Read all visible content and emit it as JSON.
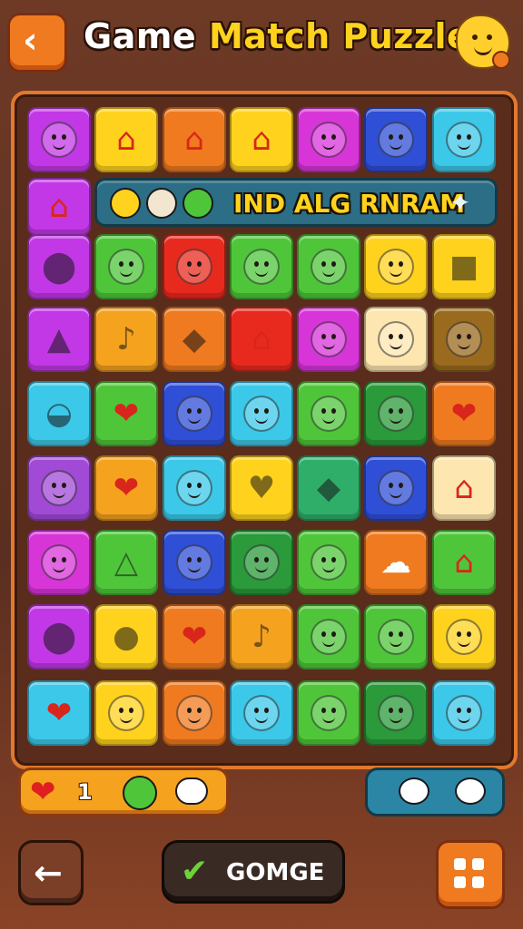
{
  "header": {
    "title_word1": "Game",
    "title_word2": "Match",
    "title_word3": "Puzzle",
    "back_icon": "chevron-left-icon",
    "profile_icon": "cookie-face-icon"
  },
  "banner": {
    "text": "IND ALG RNRAM",
    "icons": [
      "bell-icon",
      "owl-icon",
      "green-face-icon"
    ],
    "pin_icon": "pin-icon"
  },
  "board": {
    "rows": [
      [
        {
          "c": "#c238e6",
          "i": "face"
        },
        {
          "c": "#ffd21e",
          "i": "cupcake"
        },
        {
          "c": "#f07a1f",
          "i": "cupcake"
        },
        {
          "c": "#ffd21e",
          "i": "cupcake"
        },
        {
          "c": "#d835d8",
          "i": "face"
        },
        {
          "c": "#2f4fd6",
          "i": "face"
        },
        {
          "c": "#3cc8e8",
          "i": "face"
        }
      ],
      [
        {
          "c": "#c238e6",
          "i": "cupcake"
        }
      ],
      [
        {
          "c": "#c238e6",
          "i": "beetle"
        },
        {
          "c": "#4fc63a",
          "i": "face"
        },
        {
          "c": "#e82a1e",
          "i": "face"
        },
        {
          "c": "#4fc63a",
          "i": "face"
        },
        {
          "c": "#4fc63a",
          "i": "face"
        },
        {
          "c": "#ffd21e",
          "i": "face"
        },
        {
          "c": "#ffd21e",
          "i": "card"
        }
      ],
      [
        {
          "c": "#c238e6",
          "i": "boat"
        },
        {
          "c": "#f5a21f",
          "i": "bell"
        },
        {
          "c": "#f07a1f",
          "i": "diamond"
        },
        {
          "c": "#e82a1e",
          "i": "cupcake"
        },
        {
          "c": "#d835d8",
          "i": "face"
        },
        {
          "c": "#fde6b0",
          "i": "face"
        },
        {
          "c": "#9a6a1e",
          "i": "face"
        }
      ],
      [
        {
          "c": "#3cc8e8",
          "i": "shell"
        },
        {
          "c": "#4fc63a",
          "i": "heart"
        },
        {
          "c": "#2f4fd6",
          "i": "face"
        },
        {
          "c": "#3cc8e8",
          "i": "face"
        },
        {
          "c": "#4fc63a",
          "i": "face"
        },
        {
          "c": "#2a9a3a",
          "i": "face"
        },
        {
          "c": "#f07a1f",
          "i": "heart"
        }
      ],
      [
        {
          "c": "#a04ad6",
          "i": "face"
        },
        {
          "c": "#f5a21f",
          "i": "heart"
        },
        {
          "c": "#3cc8e8",
          "i": "face"
        },
        {
          "c": "#ffd21e",
          "i": "berry"
        },
        {
          "c": "#2fae6a",
          "i": "diamond"
        },
        {
          "c": "#2f4fd6",
          "i": "face"
        },
        {
          "c": "#fde6b0",
          "i": "cupcake"
        }
      ],
      [
        {
          "c": "#d835d8",
          "i": "face"
        },
        {
          "c": "#4fc63a",
          "i": "cat"
        },
        {
          "c": "#2f4fd6",
          "i": "face"
        },
        {
          "c": "#2a9a3a",
          "i": "face"
        },
        {
          "c": "#4fc63a",
          "i": "face"
        },
        {
          "c": "#f07a1f",
          "i": "cloud"
        },
        {
          "c": "#4fc63a",
          "i": "cupcake"
        }
      ],
      [
        {
          "c": "#c238e6",
          "i": "beetle"
        },
        {
          "c": "#ffd21e",
          "i": "blob"
        },
        {
          "c": "#f07a1f",
          "i": "heart"
        },
        {
          "c": "#f5a21f",
          "i": "bell"
        },
        {
          "c": "#4fc63a",
          "i": "face"
        },
        {
          "c": "#4fc63a",
          "i": "face"
        },
        {
          "c": "#ffd21e",
          "i": "face"
        }
      ],
      [
        {
          "c": "#3cc8e8",
          "i": "heart"
        },
        {
          "c": "#ffd21e",
          "i": "face"
        },
        {
          "c": "#f07a1f",
          "i": "face"
        },
        {
          "c": "#3cc8e8",
          "i": "face"
        },
        {
          "c": "#4fc63a",
          "i": "face"
        },
        {
          "c": "#2a9a3a",
          "i": "face"
        },
        {
          "c": "#3cc8e8",
          "i": "face"
        }
      ]
    ]
  },
  "status": {
    "lives": "1",
    "heart_icon": "heart-icon",
    "face_icon": "green-face-icon",
    "cloud_icon": "cloud-icon"
  },
  "chat": {
    "icons": [
      "speech-bubble-icon",
      "speech-bubble-icon"
    ]
  },
  "footer": {
    "back_icon": "arrow-left-icon",
    "change_label": "GOMGE",
    "check_icon": "checkmark-icon",
    "menu_icon": "grid-icon"
  }
}
